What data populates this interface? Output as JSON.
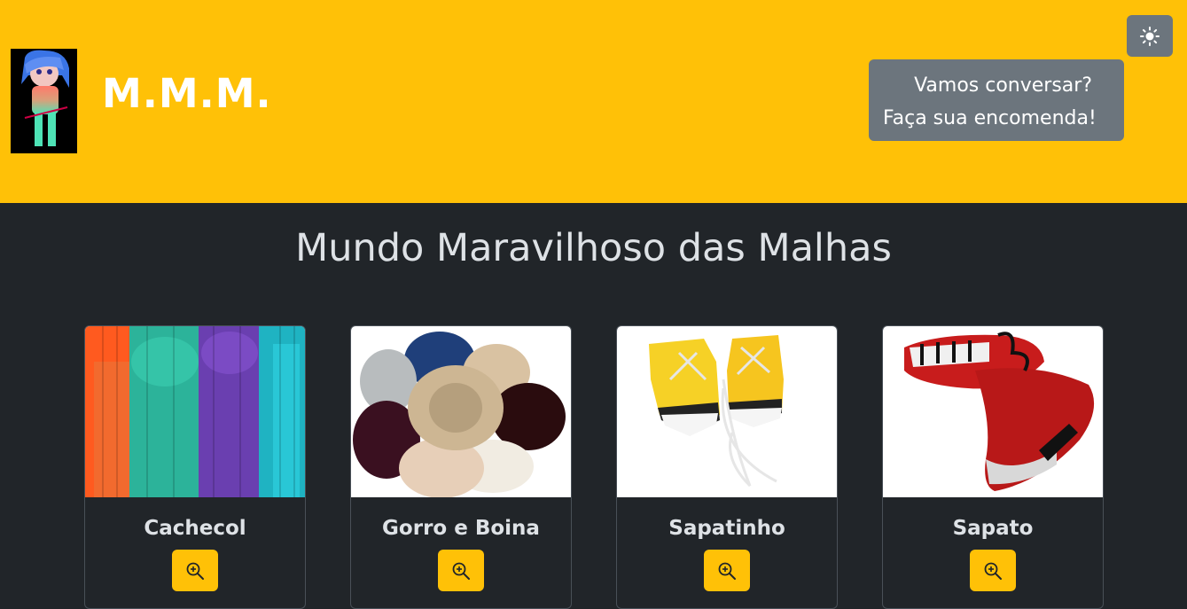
{
  "header": {
    "brand": "M.M.M.",
    "logo_icon": "knitting-girl-icon",
    "theme_toggle_icon": "sun-icon",
    "contact": {
      "line1": "Vamos conversar?",
      "line2": "Faça sua encomenda!"
    }
  },
  "main": {
    "title": "Mundo Maravilhoso das Malhas"
  },
  "cards": [
    {
      "title": "Cachecol",
      "image": "knitted-scarves-image",
      "button_icon": "zoom-in-icon"
    },
    {
      "title": "Gorro e Boina",
      "image": "knitted-hats-image",
      "button_icon": "zoom-in-icon"
    },
    {
      "title": "Sapatinho",
      "image": "baby-crochet-shoes-image",
      "button_icon": "zoom-in-icon"
    },
    {
      "title": "Sapato",
      "image": "crochet-shoes-image",
      "button_icon": "zoom-in-icon"
    }
  ],
  "colors": {
    "header_bg": "#ffc107",
    "page_bg": "#212529",
    "button_secondary": "#6c757d",
    "button_warning": "#ffc107",
    "text_light": "#dee2e6"
  }
}
